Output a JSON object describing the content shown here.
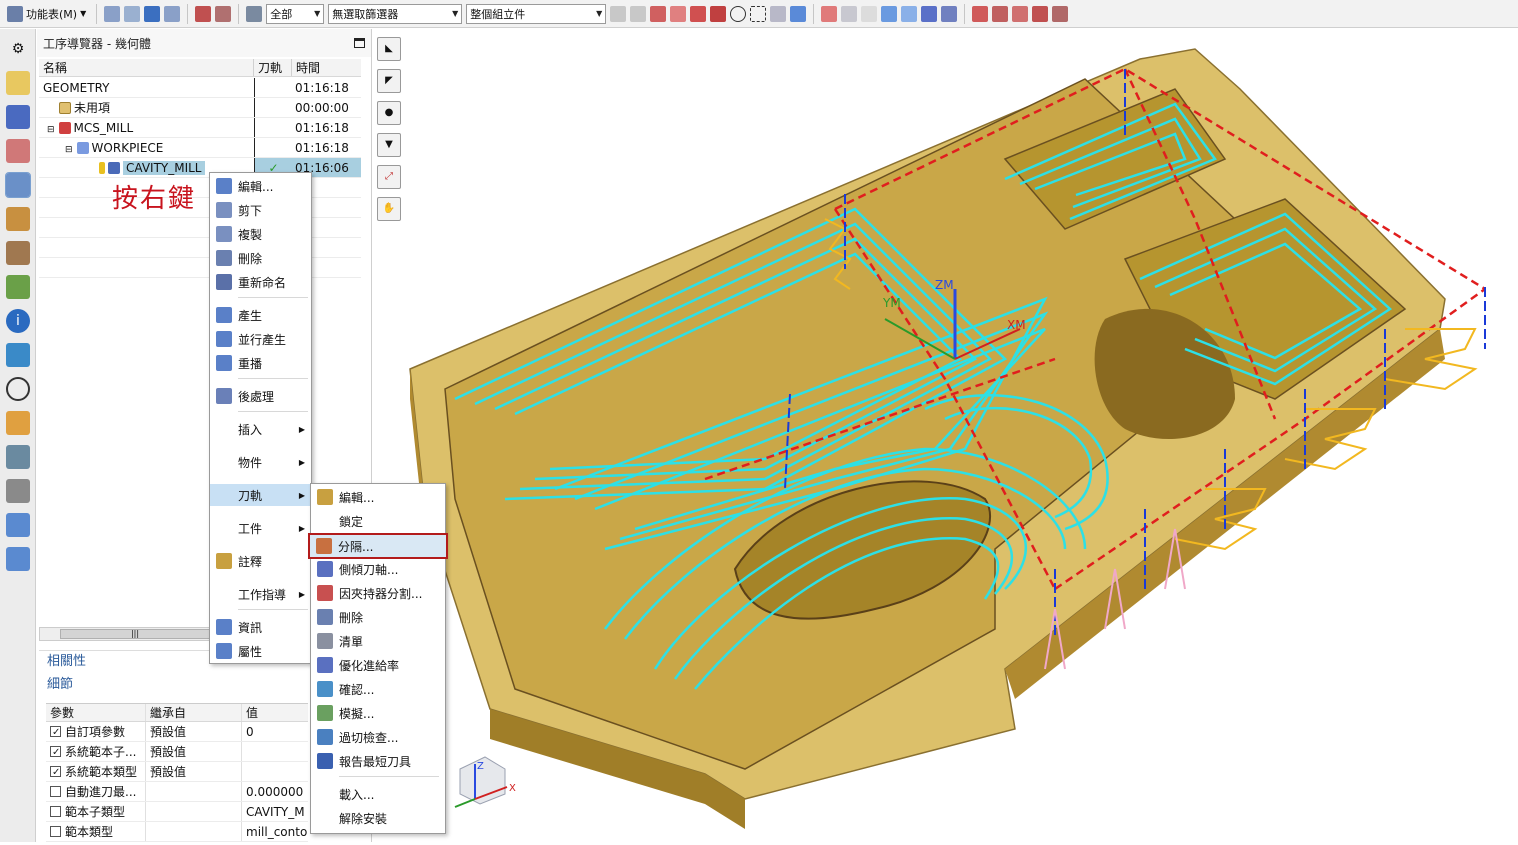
{
  "toolbar": {
    "menu_label": "功能表(M)",
    "filter_all": "全部",
    "selection_filter": "無選取篩選器",
    "assembly_scope": "整個組立件"
  },
  "navigator": {
    "title": "工序導覽器 - 幾何體",
    "columns": [
      "名稱",
      "刀軌",
      "時間"
    ],
    "rows": [
      {
        "name": "GEOMETRY",
        "time": "01:16:18"
      },
      {
        "name": "未用項",
        "time": "00:00:00"
      },
      {
        "name": "MCS_MILL",
        "time": "01:16:18"
      },
      {
        "name": "WORKPIECE",
        "time": "01:16:18"
      },
      {
        "name": "CAVITY_MILL",
        "time": "01:16:06",
        "toolpath": "✓"
      }
    ]
  },
  "annotation": "按右鍵",
  "sections": {
    "related": "相關性",
    "details": "細節"
  },
  "params": {
    "columns": [
      "參數",
      "繼承自",
      "值"
    ],
    "rows": [
      {
        "name": "自訂項參數",
        "from": "預設值",
        "value": "0",
        "checked": true
      },
      {
        "name": "系統範本子...",
        "from": "預設值",
        "value": "",
        "checked": true
      },
      {
        "name": "系統範本類型",
        "from": "預設值",
        "value": "",
        "checked": true
      },
      {
        "name": "自動進刀最...",
        "from": "",
        "value": "0.000000",
        "checked": false
      },
      {
        "name": "範本子類型",
        "from": "",
        "value": "CAVITY_M",
        "checked": false
      },
      {
        "name": "範本類型",
        "from": "",
        "value": "mill_conto",
        "checked": false
      }
    ]
  },
  "context_menu": {
    "items": [
      "編輯...",
      "剪下",
      "複製",
      "刪除",
      "重新命名",
      "產生",
      "並行產生",
      "重播",
      "後處理",
      "插入",
      "物件",
      "刀軌",
      "工件",
      "註釋",
      "工作指導",
      "資訊",
      "屬性"
    ]
  },
  "toolpath_menu": {
    "items": [
      "編輯...",
      "鎖定",
      "分隔...",
      "側傾刀軸...",
      "因夾持器分割...",
      "刪除",
      "清單",
      "優化進給率",
      "確認...",
      "模擬...",
      "過切檢查...",
      "報告最短刀具",
      "載入...",
      "解除安裝"
    ]
  },
  "view_labels": {
    "ym": "YM",
    "zm": "ZM",
    "xm": "XM",
    "z": "Z",
    "x": "X"
  },
  "colors": {
    "part": "#d8b860",
    "toolpath": "#2de0e6",
    "rapid": "#e01e1e",
    "highlight": "#b31b1b"
  }
}
